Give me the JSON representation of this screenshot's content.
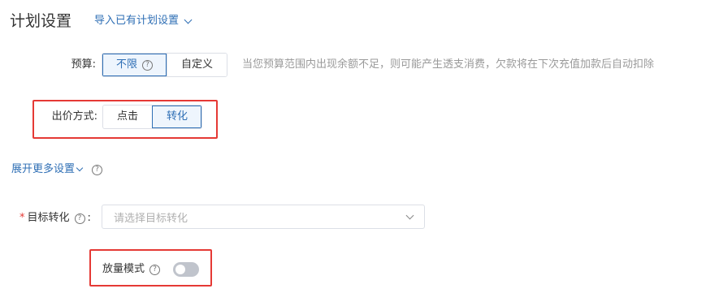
{
  "header": {
    "title": "计划设置",
    "import_link": "导入已有计划设置"
  },
  "budget": {
    "label": "预算:",
    "options": [
      {
        "label": "不限",
        "selected": true
      },
      {
        "label": "自定义",
        "selected": false
      }
    ],
    "hint": "当您预算范围内出现余额不足，则可能产生透支消费，欠款将在下次充值加款后自动扣除"
  },
  "bid_method": {
    "label": "出价方式:",
    "options": [
      {
        "label": "点击",
        "selected": false
      },
      {
        "label": "转化",
        "selected": true
      }
    ]
  },
  "expand": {
    "label": "展开更多设置"
  },
  "target_conversion": {
    "required_mark": "*",
    "label": "目标转化",
    "colon": ":",
    "placeholder": "请选择目标转化"
  },
  "volume_mode": {
    "label": "放量模式",
    "enabled": false
  },
  "colors": {
    "accent": "#2f6fb5",
    "highlight": "#e53935"
  }
}
